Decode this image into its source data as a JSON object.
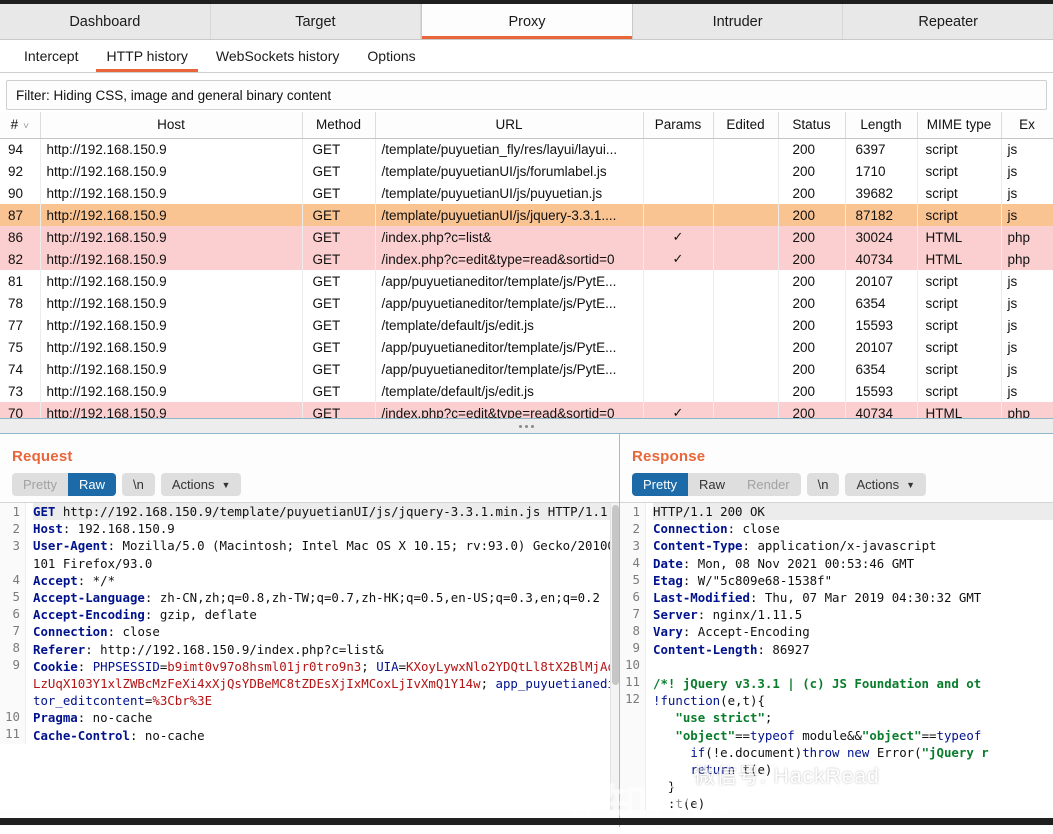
{
  "main_tabs": [
    {
      "label": "Dashboard",
      "active": false
    },
    {
      "label": "Target",
      "active": false
    },
    {
      "label": "Proxy",
      "active": true
    },
    {
      "label": "Intruder",
      "active": false
    },
    {
      "label": "Repeater",
      "active": false
    }
  ],
  "sub_tabs": [
    {
      "label": "Intercept",
      "active": false
    },
    {
      "label": "HTTP history",
      "active": true
    },
    {
      "label": "WebSockets history",
      "active": false
    },
    {
      "label": "Options",
      "active": false
    }
  ],
  "filter": {
    "text": "Filter: Hiding CSS, image and general binary content"
  },
  "table": {
    "columns": [
      "#",
      "Host",
      "Method",
      "URL",
      "Params",
      "Edited",
      "Status",
      "Length",
      "MIME type",
      "Ex"
    ],
    "sort_icon": "chevron-down-icon",
    "rows": [
      {
        "num": "94",
        "host": "http://192.168.150.9",
        "method": "GET",
        "url": "/template/puyuetian_fly/res/layui/layui...",
        "params": "",
        "edited": "",
        "status": "200",
        "length": "6397",
        "mime": "script",
        "ext": "js",
        "hl": "white"
      },
      {
        "num": "92",
        "host": "http://192.168.150.9",
        "method": "GET",
        "url": "/template/puyuetianUI/js/forumlabel.js",
        "params": "",
        "edited": "",
        "status": "200",
        "length": "1710",
        "mime": "script",
        "ext": "js",
        "hl": "white"
      },
      {
        "num": "90",
        "host": "http://192.168.150.9",
        "method": "GET",
        "url": "/template/puyuetianUI/js/puyuetian.js",
        "params": "",
        "edited": "",
        "status": "200",
        "length": "39682",
        "mime": "script",
        "ext": "js",
        "hl": "white"
      },
      {
        "num": "87",
        "host": "http://192.168.150.9",
        "method": "GET",
        "url": "/template/puyuetianUI/js/jquery-3.3.1....",
        "params": "",
        "edited": "",
        "status": "200",
        "length": "87182",
        "mime": "script",
        "ext": "js",
        "hl": "orange"
      },
      {
        "num": "86",
        "host": "http://192.168.150.9",
        "method": "GET",
        "url": "/index.php?c=list&",
        "params": "✓",
        "edited": "",
        "status": "200",
        "length": "30024",
        "mime": "HTML",
        "ext": "php",
        "hl": "pink"
      },
      {
        "num": "82",
        "host": "http://192.168.150.9",
        "method": "GET",
        "url": "/index.php?c=edit&type=read&sortid=0",
        "params": "✓",
        "edited": "",
        "status": "200",
        "length": "40734",
        "mime": "HTML",
        "ext": "php",
        "hl": "pink"
      },
      {
        "num": "81",
        "host": "http://192.168.150.9",
        "method": "GET",
        "url": "/app/puyuetianeditor/template/js/PytE...",
        "params": "",
        "edited": "",
        "status": "200",
        "length": "20107",
        "mime": "script",
        "ext": "js",
        "hl": "white"
      },
      {
        "num": "78",
        "host": "http://192.168.150.9",
        "method": "GET",
        "url": "/app/puyuetianeditor/template/js/PytE...",
        "params": "",
        "edited": "",
        "status": "200",
        "length": "6354",
        "mime": "script",
        "ext": "js",
        "hl": "white"
      },
      {
        "num": "77",
        "host": "http://192.168.150.9",
        "method": "GET",
        "url": "/template/default/js/edit.js",
        "params": "",
        "edited": "",
        "status": "200",
        "length": "15593",
        "mime": "script",
        "ext": "js",
        "hl": "white"
      },
      {
        "num": "75",
        "host": "http://192.168.150.9",
        "method": "GET",
        "url": "/app/puyuetianeditor/template/js/PytE...",
        "params": "",
        "edited": "",
        "status": "200",
        "length": "20107",
        "mime": "script",
        "ext": "js",
        "hl": "white"
      },
      {
        "num": "74",
        "host": "http://192.168.150.9",
        "method": "GET",
        "url": "/app/puyuetianeditor/template/js/PytE...",
        "params": "",
        "edited": "",
        "status": "200",
        "length": "6354",
        "mime": "script",
        "ext": "js",
        "hl": "white"
      },
      {
        "num": "73",
        "host": "http://192.168.150.9",
        "method": "GET",
        "url": "/template/default/js/edit.js",
        "params": "",
        "edited": "",
        "status": "200",
        "length": "15593",
        "mime": "script",
        "ext": "js",
        "hl": "white"
      },
      {
        "num": "70",
        "host": "http://192.168.150.9",
        "method": "GET",
        "url": "/index.php?c=edit&type=read&sortid=0",
        "params": "✓",
        "edited": "",
        "status": "200",
        "length": "40734",
        "mime": "HTML",
        "ext": "php",
        "hl": "pink"
      }
    ]
  },
  "request": {
    "title": "Request",
    "buttons": {
      "pretty": "Pretty",
      "raw": "Raw",
      "newline": "\\n",
      "actions": "Actions"
    },
    "active_view": "Raw",
    "lines": [
      {
        "n": "1",
        "html": "<span class=\"k\">GET</span> http://192.168.150.9/template/puyuetianUI/js/jquery-3.3.1.min.js HTTP/1.1"
      },
      {
        "n": "2",
        "html": "<span class=\"k\">Host</span>: 192.168.150.9"
      },
      {
        "n": "3",
        "html": "<span class=\"k\">User-Agent</span>: Mozilla/5.0 (Macintosh; Intel Mac OS X 10.15; rv:93.0) Gecko/20100101 Firefox/93.0"
      },
      {
        "n": "4",
        "html": "<span class=\"k\">Accept</span>: */*"
      },
      {
        "n": "5",
        "html": "<span class=\"k\">Accept-Language</span>: zh-CN,zh;q=0.8,zh-TW;q=0.7,zh-HK;q=0.5,en-US;q=0.3,en;q=0.2"
      },
      {
        "n": "6",
        "html": "<span class=\"k\">Accept-Encoding</span>: gzip, deflate"
      },
      {
        "n": "7",
        "html": "<span class=\"k\">Connection</span>: close"
      },
      {
        "n": "8",
        "html": "<span class=\"k\">Referer</span>: http://192.168.150.9/index.php?c=list&amp;"
      },
      {
        "n": "9",
        "html": "<span class=\"k\">Cookie</span>: <span class=\"blu\">PHPSESSID</span>=<span class=\"red\">b9imt0v97o8hsml01jr0tro9n3</span>; <span class=\"blu\">UIA</span>=<span class=\"red\">KXoyLywxNlo2YDQtLl8tX2BlMjAqLzUqX103Y1xlZWBcMzFeXi4xXjQsYDBeMC8tZDEsXjIxMCoxLjIvXmQ1Y14w</span>; <span class=\"blu\">app_puyuetianeditor_editcontent</span>=<span class=\"red\">%3Cbr%3E</span>"
      },
      {
        "n": "10",
        "html": "<span class=\"k\">Pragma</span>: no-cache"
      },
      {
        "n": "11",
        "html": "<span class=\"k\">Cache-Control</span>: no-cache"
      }
    ]
  },
  "response": {
    "title": "Response",
    "buttons": {
      "pretty": "Pretty",
      "raw": "Raw",
      "render": "Render",
      "newline": "\\n",
      "actions": "Actions"
    },
    "active_view": "Pretty",
    "lines": [
      {
        "n": "1",
        "html": "HTTP/1.1 200 OK"
      },
      {
        "n": "2",
        "html": "<span class=\"k\">Connection</span>: close"
      },
      {
        "n": "3",
        "html": "<span class=\"k\">Content-Type</span>: application/x-javascript"
      },
      {
        "n": "4",
        "html": "<span class=\"k\">Date</span>: Mon, 08 Nov 2021 00:53:46 GMT"
      },
      {
        "n": "5",
        "html": "<span class=\"k\">Etag</span>: W/\"5c809e68-1538f\""
      },
      {
        "n": "6",
        "html": "<span class=\"k\">Last-Modified</span>: Thu, 07 Mar 2019 04:30:32 GMT"
      },
      {
        "n": "7",
        "html": "<span class=\"k\">Server</span>: nginx/1.11.5"
      },
      {
        "n": "8",
        "html": "<span class=\"k\">Vary</span>: Accept-Encoding"
      },
      {
        "n": "9",
        "html": "<span class=\"k\">Content-Length</span>: 86927"
      },
      {
        "n": "10",
        "html": ""
      },
      {
        "n": "11",
        "html": "<span class=\"green\">/*! jQuery v3.3.1 | (c) JS Foundation and ot</span>"
      },
      {
        "n": "12",
        "html": "<span class=\"blu\">!function</span>(e,t){"
      },
      {
        "n": "",
        "html": "   <span class=\"green\">\"use strict\"</span>;"
      },
      {
        "n": "",
        "html": "   <span class=\"green\">\"object\"</span>==<span class=\"blu\">typeof</span> module&amp;&amp;<span class=\"green\">\"object\"</span>==<span class=\"blu\">typeof</span>"
      },
      {
        "n": "",
        "html": "     <span class=\"blu\">if</span>(!e.document)<span class=\"blu\">throw new</span> Error(<span class=\"green\">\"jQuery r</span>"
      },
      {
        "n": "",
        "html": "     <span class=\"blu\">return</span> t(e)"
      },
      {
        "n": "",
        "html": "  }"
      },
      {
        "n": "",
        "html": "  :t(e)"
      }
    ]
  },
  "watermark": {
    "text": "微信号: HackRead",
    "icon": "smiley-face-icon",
    "backdrop": "先知社区"
  },
  "colors": {
    "accent": "#e8663a",
    "selected_row": "#f9c392",
    "highlight_row": "#fbcfcf",
    "button_active": "#1c6aa8"
  }
}
